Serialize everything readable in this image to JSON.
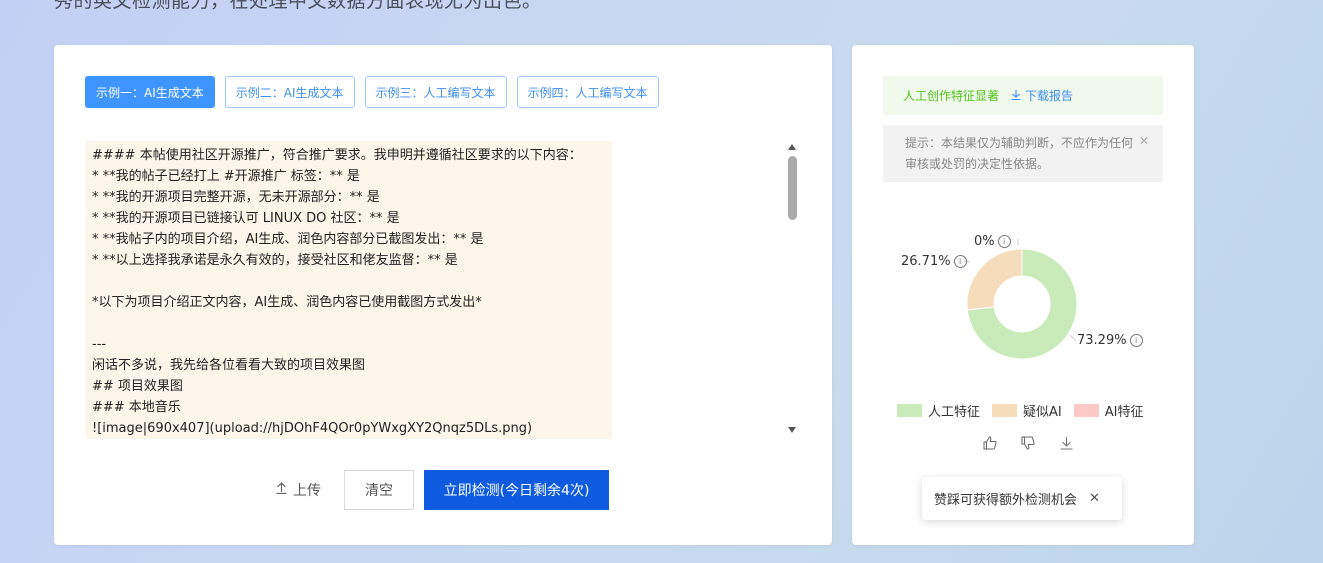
{
  "intro": {
    "text": "秀的英文检测能力，在处理中文数据方面表现尤为出色。"
  },
  "examples": [
    {
      "label": "示例一：AI生成文本",
      "active": true
    },
    {
      "label": "示例二：AI生成文本",
      "active": false
    },
    {
      "label": "示例三：人工编写文本",
      "active": false
    },
    {
      "label": "示例四：人工编写文本",
      "active": false
    }
  ],
  "editor": {
    "lines": [
      "#### 本帖使用社区开源推广，符合推广要求。我申明并遵循社区要求的以下内容：",
      "* **我的帖子已经打上 #开源推广 标签：** 是",
      "* **我的开源项目完整开源，无未开源部分：** 是",
      "* **我的开源项目已链接认可 LINUX DO 社区：** 是",
      "* **我帖子内的项目介绍，AI生成、润色内容部分已截图发出：** 是",
      "* **以上选择我承诺是永久有效的，接受社区和佬友监督：** 是",
      "",
      "*以下为项目介绍正文内容，AI生成、润色内容已使用截图方式发出*",
      "",
      "---",
      "闲话不多说，我先给各位看看大致的项目效果图",
      "## 项目效果图",
      "### 本地音乐",
      "![image|690x407](upload://hjDOhF4QOr0pYWxgXY2Qnqz5DLs.png)"
    ]
  },
  "actions": {
    "upload_label": "上传",
    "clear_label": "清空",
    "detect_label": "立即检测(今日剩余4次)"
  },
  "result": {
    "conclusion": "人工创作特征显著",
    "download_label": "下载报告",
    "tip": "提示：本结果仅为辅助判断，不应作为任何审核或处罚的决定性依据。"
  },
  "chart_data": {
    "type": "pie",
    "title": "",
    "categories": [
      "人工特征",
      "疑似AI",
      "AI特征"
    ],
    "values": [
      73.29,
      26.71,
      0
    ],
    "value_labels": [
      "73.29%",
      "26.71%",
      "0%"
    ],
    "colors": [
      "#c9eab9",
      "#f6dcbb",
      "#fcc8c8"
    ],
    "legend_position": "bottom"
  },
  "toast": {
    "text": "赞踩可获得额外检测机会"
  },
  "icons": {
    "upload": "upload-icon",
    "download": "download-icon",
    "like": "thumbs-up-icon",
    "dislike": "thumbs-down-icon",
    "report_download": "download-icon",
    "close": "close-icon"
  }
}
